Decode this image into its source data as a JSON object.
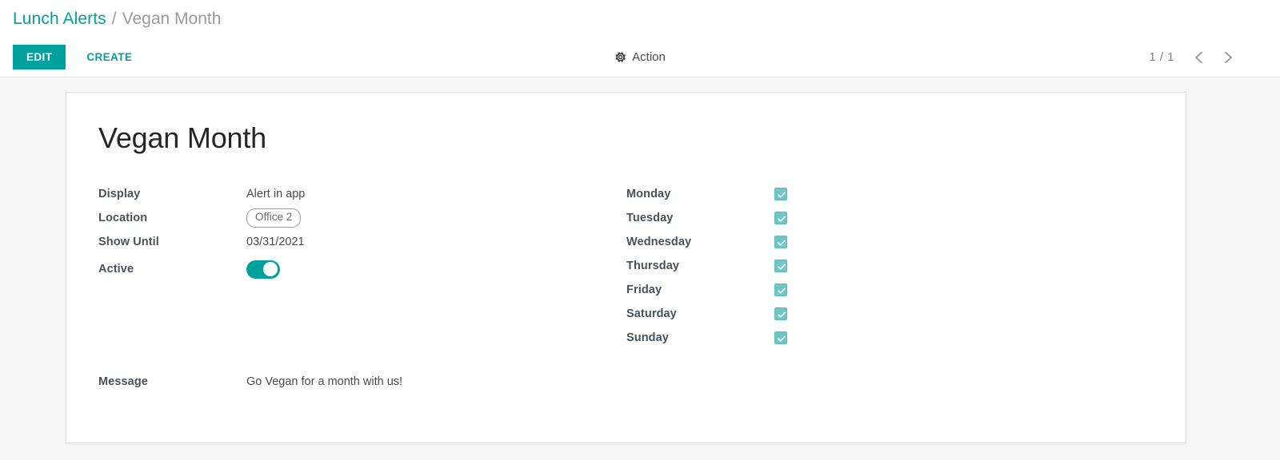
{
  "breadcrumb": {
    "root": "Lunch Alerts",
    "separator": "/",
    "current": "Vegan Month"
  },
  "control_panel": {
    "edit_label": "EDIT",
    "create_label": "CREATE",
    "action_label": "Action",
    "gear_icon": "gear-icon",
    "pager_text": "1 / 1",
    "prev_icon": "chevron-left-icon",
    "next_icon": "chevron-right-icon"
  },
  "record": {
    "title": "Vegan Month",
    "fields": {
      "display": {
        "label": "Display",
        "value": "Alert in app"
      },
      "location": {
        "label": "Location",
        "value": "Office 2"
      },
      "show_until": {
        "label": "Show Until",
        "value": "03/31/2021"
      },
      "active": {
        "label": "Active",
        "value": "on"
      }
    },
    "days": [
      {
        "label": "Monday",
        "checked": true
      },
      {
        "label": "Tuesday",
        "checked": true
      },
      {
        "label": "Wednesday",
        "checked": true
      },
      {
        "label": "Thursday",
        "checked": true
      },
      {
        "label": "Friday",
        "checked": true
      },
      {
        "label": "Saturday",
        "checked": true
      },
      {
        "label": "Sunday",
        "checked": true
      }
    ],
    "message": {
      "label": "Message",
      "value": "Go Vegan for a month with us!"
    }
  },
  "colors": {
    "accent": "#00a09d",
    "checkbox": "#6fc7c5",
    "label_text": "#49515a",
    "value_text": "#4c4c4c",
    "muted": "#9b9b9b",
    "page_bg": "#f6f6f6"
  }
}
